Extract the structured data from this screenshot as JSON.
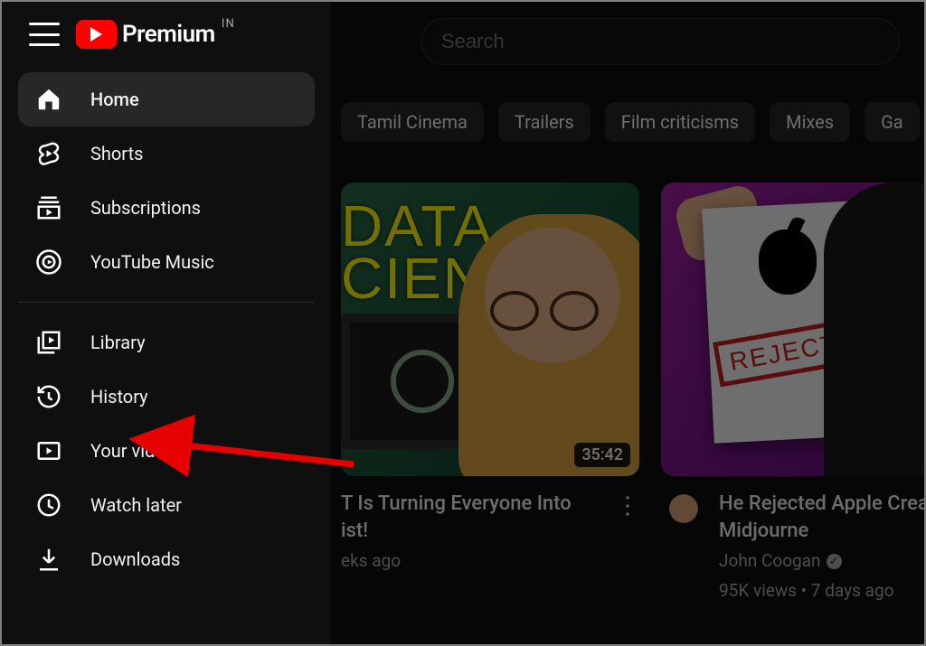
{
  "header": {
    "logo_text": "Premium",
    "region": "IN",
    "search_placeholder": "Search"
  },
  "chips": [
    "Tamil Cinema",
    "Trailers",
    "Film criticisms",
    "Mixes",
    "Ga"
  ],
  "sidebar": {
    "section1": [
      {
        "label": "Home",
        "active": true
      },
      {
        "label": "Shorts"
      },
      {
        "label": "Subscriptions"
      },
      {
        "label": "YouTube Music"
      }
    ],
    "section2": [
      {
        "label": "Library"
      },
      {
        "label": "History"
      },
      {
        "label": "Your videos"
      },
      {
        "label": "Watch later"
      },
      {
        "label": "Downloads"
      }
    ]
  },
  "videos": [
    {
      "thumb_text1": "DATA",
      "thumb_text2": "CIENTIST",
      "duration": "35:42",
      "title": "T Is Turning Everyone Into ist!",
      "meta_line": "eks ago"
    },
    {
      "stamp": "REJECTED",
      "title": "He Rejected Apple Created Midjourne",
      "channel": "John Coogan",
      "meta_line": "95K views • 7 days ago"
    }
  ]
}
